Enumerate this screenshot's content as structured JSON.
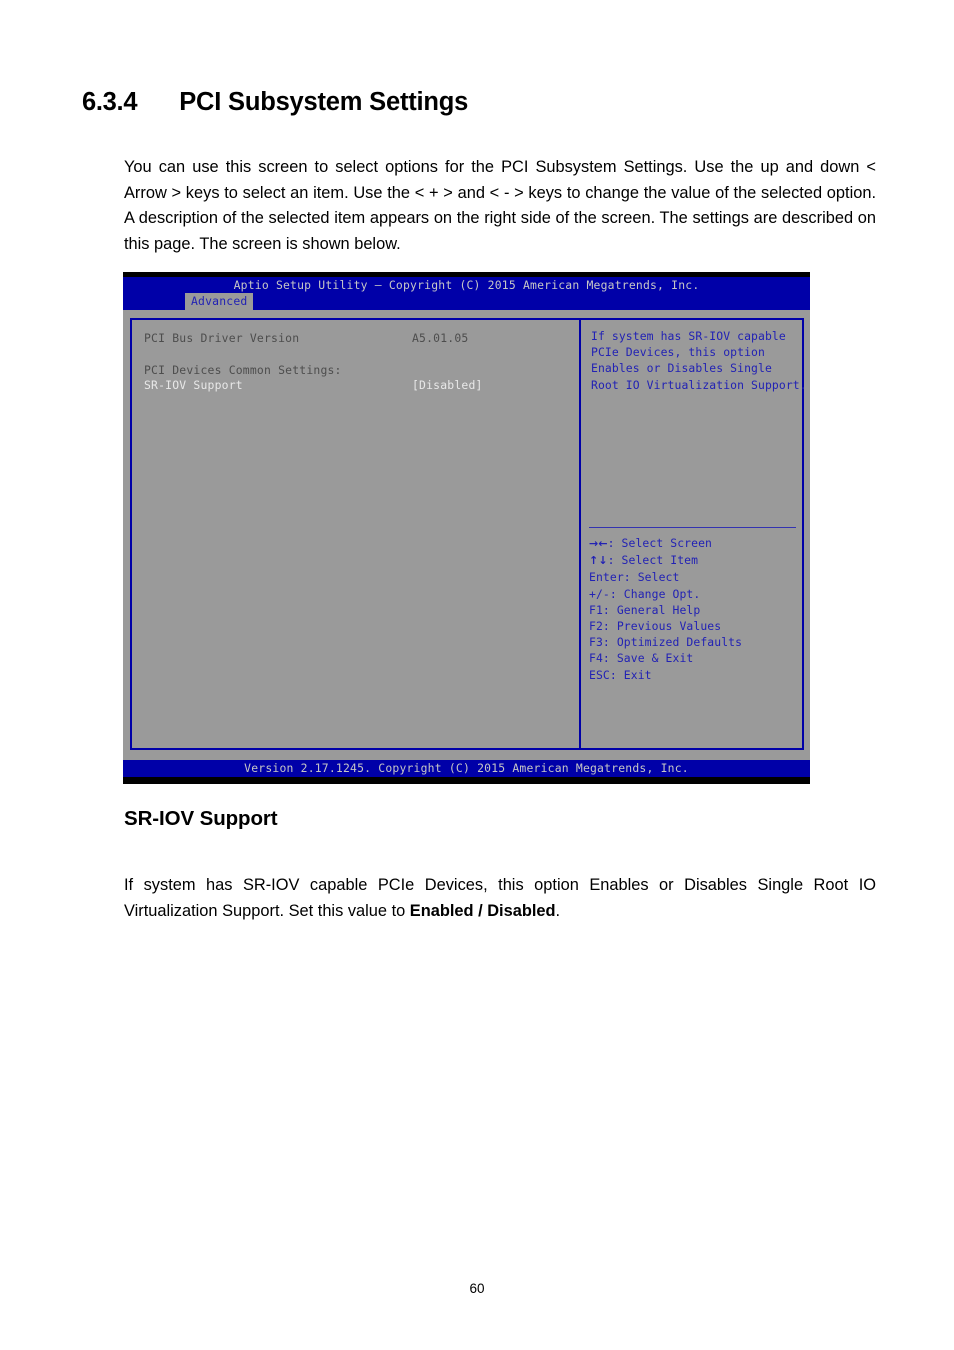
{
  "document": {
    "section_number": "6.3.4",
    "section_title": "PCI Subsystem Settings",
    "intro_paragraph": "You can use this screen to select options for the PCI Subsystem Settings. Use the up and down < Arrow > keys to select an item. Use the < + > and < - > keys to change the value of the selected option. A description of the selected item appears on the right side of the screen. The settings are described on this page. The screen is shown below.",
    "sub_heading": "SR-IOV Support",
    "sub_paragraph_before": "If system has SR-IOV capable PCIe Devices, this option Enables or Disables Single Root IO Virtualization Support. Set this value to ",
    "sub_paragraph_bold": "Enabled / Disabled",
    "sub_paragraph_after": ".",
    "page_number": "60"
  },
  "bios": {
    "title": "Aptio Setup Utility – Copyright (C) 2015 American Megatrends, Inc.",
    "active_tab": "Advanced",
    "tabs": [
      "Advanced"
    ],
    "settings": [
      {
        "label": "PCI Bus Driver Version",
        "value": "A5.01.05",
        "style": "info"
      },
      {
        "label": "PCI Devices Common Settings:",
        "value": "",
        "style": "info"
      },
      {
        "label": "SR-IOV Support",
        "value": "[Disabled]",
        "style": "active"
      }
    ],
    "help": {
      "lines": [
        "If system has SR-IOV capable",
        "PCIe Devices, this option",
        "Enables or Disables Single",
        "Root IO Virtualization Support."
      ]
    },
    "key_legend": [
      {
        "keys": "→←",
        "action": ": Select Screen"
      },
      {
        "keys": "↑↓",
        "action": ": Select Item"
      },
      {
        "keys": "Enter",
        "action": ": Select"
      },
      {
        "keys": "+/-",
        "action": ": Change Opt."
      },
      {
        "keys": "F1",
        "action": ": General Help"
      },
      {
        "keys": "F2",
        "action": ": Previous Values"
      },
      {
        "keys": "F3",
        "action": ": Optimized Defaults"
      },
      {
        "keys": "F4",
        "action": ": Save & Exit"
      },
      {
        "keys": "ESC",
        "action": ": Exit"
      }
    ],
    "footer": "Version 2.17.1245. Copyright (C) 2015 American Megatrends, Inc."
  },
  "colors": {
    "bios_blue": "#0000a8",
    "bios_gray": "#9a9a9a",
    "bios_text_blue": "#2222b4",
    "bios_title_text": "#c6c6c6"
  }
}
